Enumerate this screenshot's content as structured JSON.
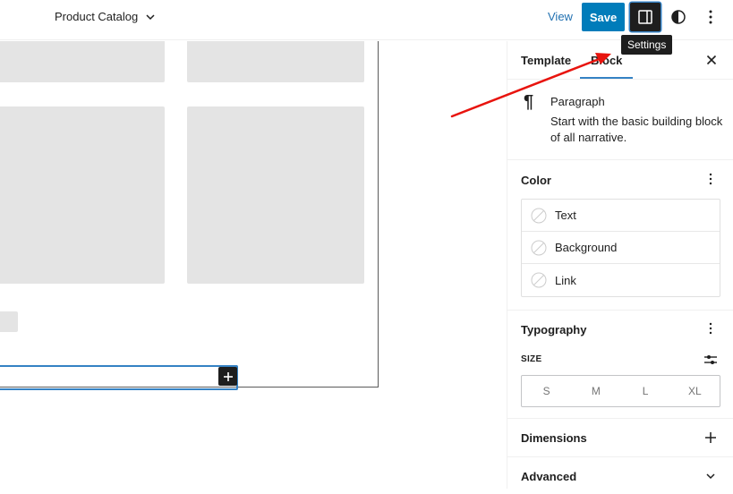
{
  "header": {
    "document_title": "Product Catalog",
    "view_label": "View",
    "save_label": "Save",
    "settings_tooltip": "Settings",
    "icons": {
      "title_dropdown": "chevron-down-icon",
      "settings": "sidebar-toggle-icon",
      "styles": "half-circle-contrast-icon",
      "more": "vertical-ellipsis-icon"
    }
  },
  "sidebar": {
    "tabs": [
      {
        "label": "Template",
        "active": false
      },
      {
        "label": "Block",
        "active": true
      }
    ],
    "close_icon": "close-icon",
    "block": {
      "icon": "¶",
      "name": "Paragraph",
      "description": "Start with the basic building block of all narrative."
    },
    "color_panel": {
      "title": "Color",
      "items": [
        {
          "label": "Text"
        },
        {
          "label": "Background"
        },
        {
          "label": "Link"
        }
      ]
    },
    "typography_panel": {
      "title": "Typography",
      "size_label": "SIZE",
      "sizes": [
        "S",
        "M",
        "L",
        "XL"
      ]
    },
    "dimensions_panel": {
      "title": "Dimensions"
    },
    "advanced_panel": {
      "title": "Advanced"
    }
  },
  "annotation": {
    "type": "arrow",
    "color": "#e8140e",
    "points_to": "settings-button"
  },
  "colors": {
    "accent": "#007cba",
    "focus": "#3582c4",
    "placeholder": "#e4e4e4"
  }
}
